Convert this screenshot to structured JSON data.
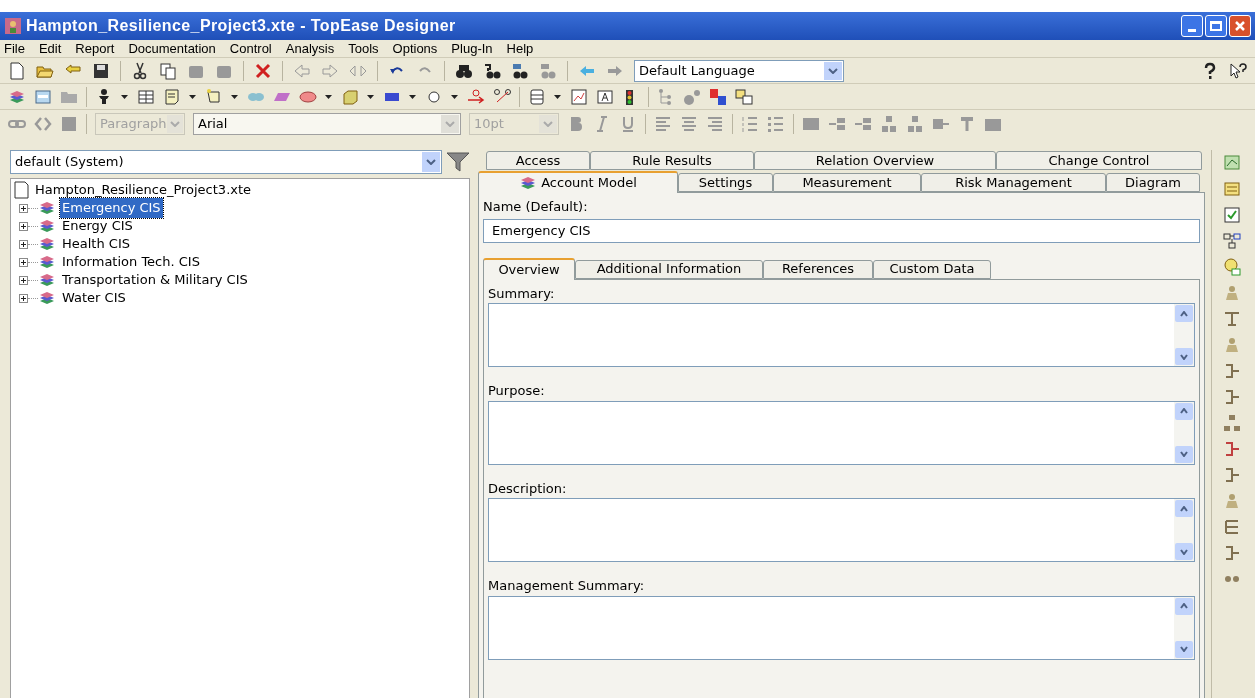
{
  "window": {
    "title": "Hampton_Resilience_Project3.xte - TopEase Designer"
  },
  "menu": [
    "File",
    "Edit",
    "Report",
    "Documentation",
    "Control",
    "Analysis",
    "Tools",
    "Options",
    "Plug-In",
    "Help"
  ],
  "toolbar": {
    "language": "Default Language"
  },
  "format_bar": [
    {
      "kind": "dropdown",
      "value": "Paragraph",
      "disabled": true
    },
    {
      "kind": "dropdown",
      "value": "Arial",
      "disabled": false
    },
    {
      "kind": "dropdown",
      "value": "10pt",
      "disabled": true
    }
  ],
  "filter": {
    "value": "default (System)"
  },
  "tree": {
    "label": "Hampton_Resilience_Project3.xte",
    "children": [
      {
        "label": "Emergency CIS",
        "selected": true,
        "expanded": false
      },
      {
        "label": "Energy CIS",
        "selected": false,
        "expanded": false
      },
      {
        "label": "Health CIS",
        "selected": false,
        "expanded": false
      },
      {
        "label": "Information Tech. CIS",
        "selected": false,
        "expanded": false
      },
      {
        "label": "Transportation & Military CIS",
        "selected": false,
        "expanded": false
      },
      {
        "label": "Water CIS",
        "selected": false,
        "expanded": false
      }
    ]
  },
  "tabs_back": [
    {
      "label": "Access",
      "selected": false
    },
    {
      "label": "Rule Results",
      "selected": false
    },
    {
      "label": "Relation Overview",
      "selected": false
    },
    {
      "label": "Change Control",
      "selected": false
    }
  ],
  "tabs_front": [
    {
      "label": "Account Model",
      "selected": true
    },
    {
      "label": "Settings",
      "selected": false
    },
    {
      "label": "Measurement",
      "selected": false
    },
    {
      "label": "Risk Management",
      "selected": false
    },
    {
      "label": "Diagram",
      "selected": false
    }
  ],
  "name_field": {
    "label": "Name (Default):",
    "value": "Emergency CIS"
  },
  "subtabs": [
    {
      "label": "Overview",
      "selected": true
    },
    {
      "label": "Additional Information",
      "selected": false
    },
    {
      "label": "References",
      "selected": false
    },
    {
      "label": "Custom Data",
      "selected": false
    }
  ],
  "text_areas": [
    {
      "label": "Summary:"
    },
    {
      "label": "Purpose:"
    },
    {
      "label": "Description:"
    },
    {
      "label": "Management Summary:"
    }
  ]
}
